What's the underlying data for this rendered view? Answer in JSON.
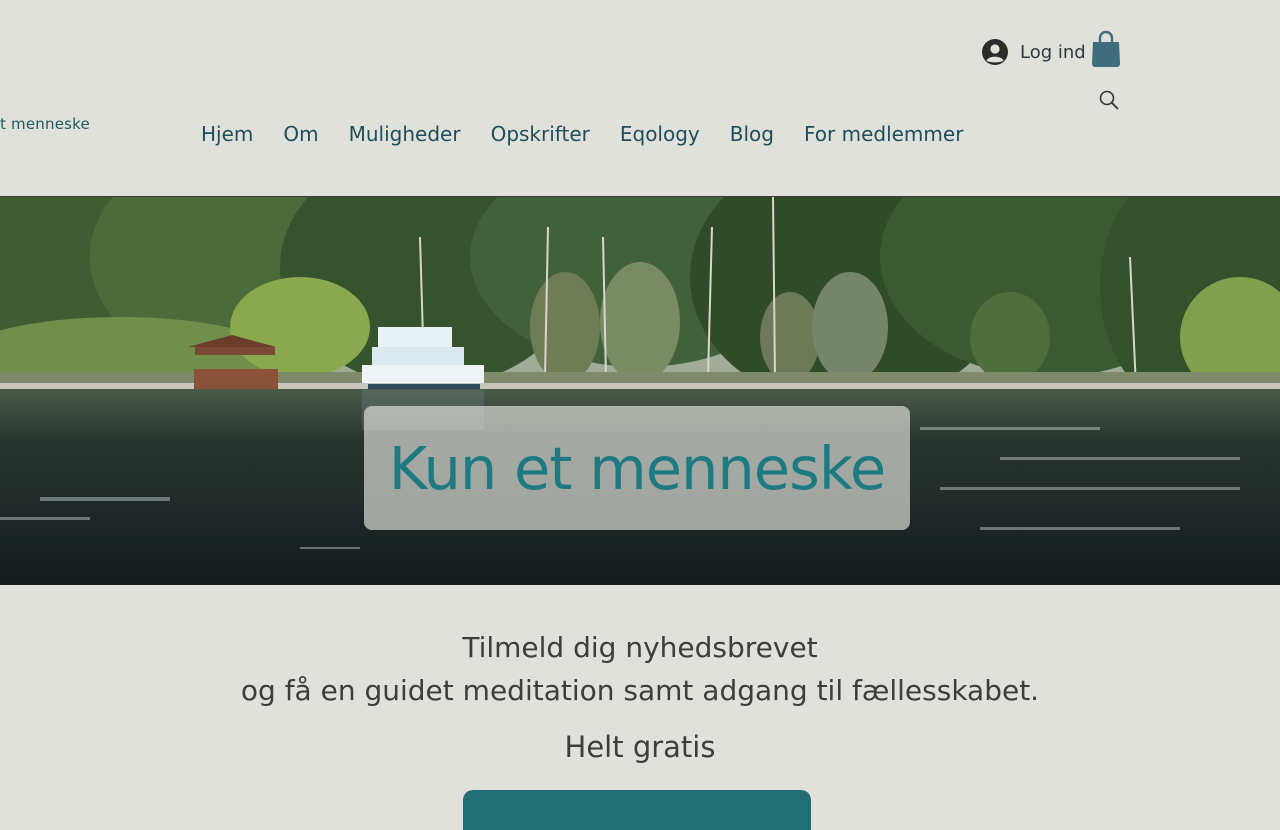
{
  "header": {
    "logo_text": "t menneske",
    "login_label": "Log ind",
    "nav": [
      {
        "label": "Hjem"
      },
      {
        "label": "Om"
      },
      {
        "label": "Muligheder"
      },
      {
        "label": "Opskrifter"
      },
      {
        "label": "Eqology"
      },
      {
        "label": "Blog"
      },
      {
        "label": "For medlemmer"
      }
    ],
    "icons": [
      "avatar-icon",
      "cart-icon",
      "search-icon"
    ]
  },
  "hero": {
    "title": "Kun et menneske"
  },
  "newsletter": {
    "line1": "Tilmeld dig nyhedsbrevet",
    "line2": "og få en guidet meditation samt adgang til fællesskabet.",
    "free": "Helt gratis"
  },
  "colors": {
    "background": "#e0e1db",
    "accent": "#216e74",
    "nav_text": "#1f4e5a",
    "title_text": "#1e7a80"
  }
}
